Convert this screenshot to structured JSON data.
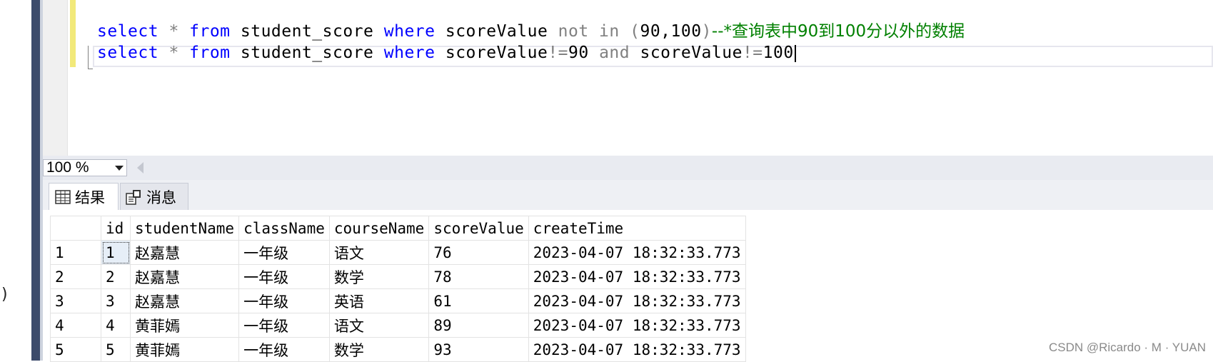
{
  "left_pane": {
    "paren": ")"
  },
  "editor": {
    "line1": {
      "t1": "select",
      "t2": " * ",
      "t3": "from",
      "t4": " student_score ",
      "t5": "where",
      "t6": " scoreValue ",
      "t7": "not in",
      "t8": " (",
      "t9": "90,100",
      "t10": ")",
      "comment": "--*查询表中90到100分以外的数据"
    },
    "line2": {
      "t1": "select",
      "t2": " * ",
      "t3": "from",
      "t4": " student_score ",
      "t5": "where",
      "t6": " scoreValue",
      "t7": "!=",
      "t8": "90 ",
      "t9": "and",
      "t10": " scoreValue",
      "t11": "!=",
      "t12": "100"
    }
  },
  "zoom": {
    "value": "100 %"
  },
  "tabs": {
    "results": "结果",
    "messages": "消息"
  },
  "results": {
    "columns": [
      "",
      "id",
      "studentName",
      "className",
      "courseName",
      "scoreValue",
      "createTime"
    ],
    "rows": [
      [
        "1",
        "1",
        "赵嘉慧",
        "一年级",
        "语文",
        "76",
        "2023-04-07 18:32:33.773"
      ],
      [
        "2",
        "2",
        "赵嘉慧",
        "一年级",
        "数学",
        "78",
        "2023-04-07 18:32:33.773"
      ],
      [
        "3",
        "3",
        "赵嘉慧",
        "一年级",
        "英语",
        "61",
        "2023-04-07 18:32:33.773"
      ],
      [
        "4",
        "4",
        "黄菲嫣",
        "一年级",
        "语文",
        "89",
        "2023-04-07 18:32:33.773"
      ],
      [
        "5",
        "5",
        "黄菲嫣",
        "一年级",
        "数学",
        "93",
        "2023-04-07 18:32:33.773"
      ]
    ]
  },
  "watermark": "CSDN @Ricardo · M · YUAN",
  "colors": {
    "keyword": "#0000ff",
    "operator": "#808080",
    "comment": "#008000",
    "splitter": "#3c4b6b"
  }
}
